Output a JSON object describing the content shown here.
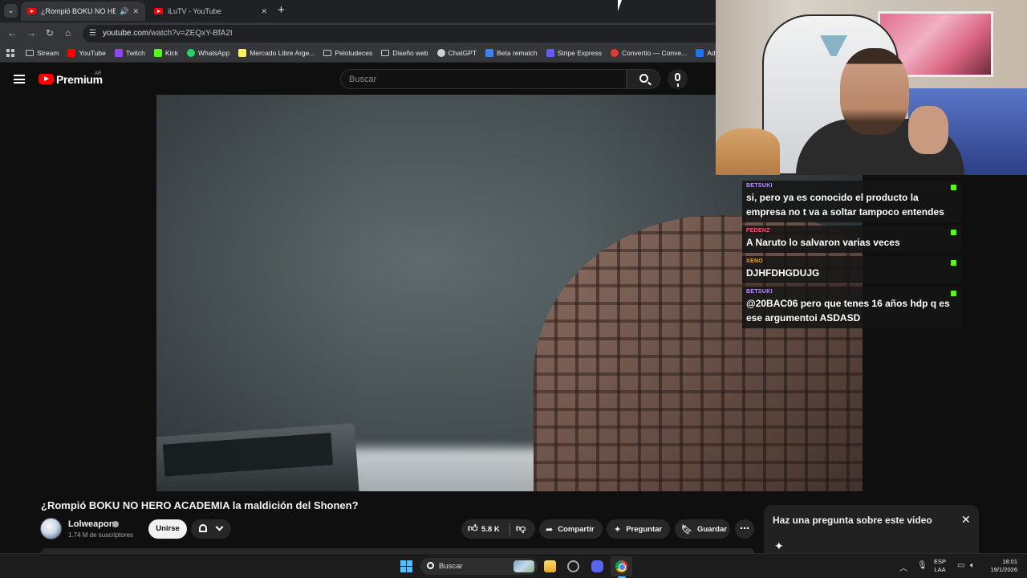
{
  "browser": {
    "tabs": [
      {
        "title": "¿Rompió BOKU NO HERO ACADEMIA la maldición del Shonen? - YouTube",
        "active": true
      },
      {
        "title": "iLuTV - YouTube",
        "active": false
      }
    ],
    "url_host": "youtube.com",
    "url_path": "/watch?v=ZEQxY-BfA2I",
    "bookmarks": [
      {
        "label": "Stream",
        "icon": "folder-icon"
      },
      {
        "label": "YouTube",
        "icon": "youtube-icon",
        "color": "#ff0000"
      },
      {
        "label": "Twitch",
        "icon": "twitch-icon",
        "color": "#9146ff"
      },
      {
        "label": "Kick",
        "icon": "kick-icon",
        "color": "#53fc18"
      },
      {
        "label": "WhatsApp",
        "icon": "whatsapp-icon",
        "color": "#25d366"
      },
      {
        "label": "Mercado Libre Arge...",
        "icon": "mercadolibre-icon",
        "color": "#fff159"
      },
      {
        "label": "Pelotudeces",
        "icon": "folder-icon"
      },
      {
        "label": "Diseño web",
        "icon": "folder-icon"
      },
      {
        "label": "ChatGPT",
        "icon": "chatgpt-icon",
        "color": "#cfcfcf"
      },
      {
        "label": "Beta rematch",
        "icon": "beta-icon",
        "color": "#3b82f6"
      },
      {
        "label": "Stripe Express",
        "icon": "stripe-icon",
        "color": "#635bff"
      },
      {
        "label": "Convertio — Conve...",
        "icon": "convertio-icon",
        "color": "#e53935"
      },
      {
        "label": "Administ",
        "icon": "meta-icon",
        "color": "#1877f2"
      }
    ]
  },
  "youtube": {
    "brand": "Premium",
    "region": "AR",
    "search_placeholder": "Buscar",
    "video_title": "¿Rompió BOKU NO HERO ACADEMIA la maldición del Shonen?",
    "channel_name": "Lolweapon",
    "subscribers": "1.74 M de suscriptores",
    "join_label": "Unirse",
    "likes": "5.8 K",
    "share_label": "Compartir",
    "ask_label": "Preguntar",
    "save_label": "Guardar",
    "ask_panel_title": "Haz una pregunta sobre este video"
  },
  "chat": [
    {
      "user": "BETSUKI",
      "user_color": "#c08cff",
      "text": "si, pero ya es conocido el producto la empresa no t va a soltar tampoco entendes"
    },
    {
      "user": "FEDENZ",
      "user_color": "#ff4f6d",
      "text": "A Naruto lo salvaron varias veces"
    },
    {
      "user": "XENO",
      "user_color": "#f0a030",
      "text": "DJHFDHGDUJG"
    },
    {
      "user": "BETSUKI",
      "user_color": "#c08cff",
      "text": "@20BAC06 pero que tenes 16 años hdp q es ese argumentoi ASDASD"
    }
  ],
  "taskbar": {
    "search_label": "Buscar",
    "lang_1": "ESP",
    "lang_2": "LAA",
    "time": "18:01",
    "date": "19/1/2026"
  }
}
